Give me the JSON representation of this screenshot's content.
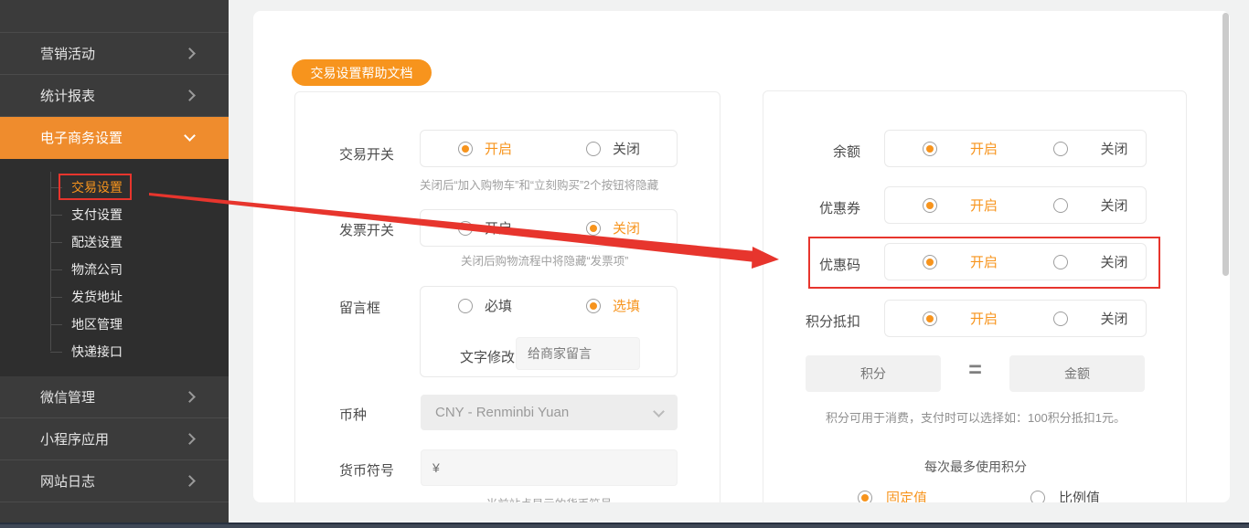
{
  "colors": {
    "accent": "#f7941d",
    "menu_active_bg": "#ef8c2d",
    "annotation_red": "#e7352d",
    "sidebar_bg": "#3b3b3b",
    "submenu_bg": "#2e2e2e"
  },
  "sidebar": {
    "top_items": [
      {
        "label": "营销活动"
      },
      {
        "label": "统计报表"
      }
    ],
    "active_item": {
      "label": "电子商务设置"
    },
    "submenu": [
      {
        "label": "交易设置"
      },
      {
        "label": "支付设置"
      },
      {
        "label": "配送设置"
      },
      {
        "label": "物流公司"
      },
      {
        "label": "发货地址"
      },
      {
        "label": "地区管理"
      },
      {
        "label": "快递接口"
      }
    ],
    "bottom_items": [
      {
        "label": "微信管理"
      },
      {
        "label": "小程序应用"
      },
      {
        "label": "网站日志"
      }
    ]
  },
  "toolbar": {
    "help_button": "交易设置帮助文档"
  },
  "left_panel": {
    "trade_switch": {
      "label": "交易开关",
      "on": "开启",
      "off": "关闭",
      "note": "关闭后“加入购物车”和“立刻购买”2个按钮将隐藏"
    },
    "invoice_switch": {
      "label": "发票开关",
      "on": "开启",
      "off": "关闭",
      "note": "关闭后购物流程中将隐藏“发票项”"
    },
    "message_box": {
      "label": "留言框",
      "required": "必填",
      "optional": "选填",
      "edit_label": "文字修改",
      "input_value": "给商家留言"
    },
    "currency": {
      "label": "币种",
      "value": "CNY - Renminbi Yuan"
    },
    "currency_symbol": {
      "label": "货币符号",
      "value": "¥",
      "note": "当前站点显示的货币符号"
    }
  },
  "right_panel": {
    "balance": {
      "label": "余额",
      "on": "开启",
      "off": "关闭"
    },
    "coupon": {
      "label": "优惠券",
      "on": "开启",
      "off": "关闭"
    },
    "promo_code": {
      "label": "优惠码",
      "on": "开启",
      "off": "关闭"
    },
    "points_deduction": {
      "label": "积分抵扣",
      "on": "开启",
      "off": "关闭"
    },
    "exchange": {
      "points_placeholder": "积分",
      "equals": "=",
      "amount_placeholder": "金额",
      "note": "积分可用于消费，支付时可以选择如：100积分抵扣1元。"
    },
    "max_points": {
      "title": "每次最多使用积分",
      "fixed": "固定值",
      "ratio": "比例值"
    }
  }
}
